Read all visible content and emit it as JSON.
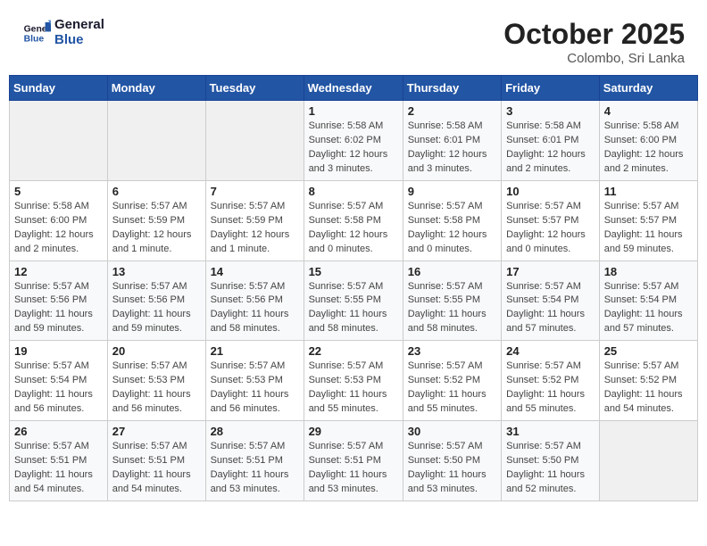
{
  "header": {
    "logo_general": "General",
    "logo_blue": "Blue",
    "month_year": "October 2025",
    "location": "Colombo, Sri Lanka"
  },
  "weekdays": [
    "Sunday",
    "Monday",
    "Tuesday",
    "Wednesday",
    "Thursday",
    "Friday",
    "Saturday"
  ],
  "weeks": [
    [
      {
        "day": "",
        "info": ""
      },
      {
        "day": "",
        "info": ""
      },
      {
        "day": "",
        "info": ""
      },
      {
        "day": "1",
        "info": "Sunrise: 5:58 AM\nSunset: 6:02 PM\nDaylight: 12 hours\nand 3 minutes."
      },
      {
        "day": "2",
        "info": "Sunrise: 5:58 AM\nSunset: 6:01 PM\nDaylight: 12 hours\nand 3 minutes."
      },
      {
        "day": "3",
        "info": "Sunrise: 5:58 AM\nSunset: 6:01 PM\nDaylight: 12 hours\nand 2 minutes."
      },
      {
        "day": "4",
        "info": "Sunrise: 5:58 AM\nSunset: 6:00 PM\nDaylight: 12 hours\nand 2 minutes."
      }
    ],
    [
      {
        "day": "5",
        "info": "Sunrise: 5:58 AM\nSunset: 6:00 PM\nDaylight: 12 hours\nand 2 minutes."
      },
      {
        "day": "6",
        "info": "Sunrise: 5:57 AM\nSunset: 5:59 PM\nDaylight: 12 hours\nand 1 minute."
      },
      {
        "day": "7",
        "info": "Sunrise: 5:57 AM\nSunset: 5:59 PM\nDaylight: 12 hours\nand 1 minute."
      },
      {
        "day": "8",
        "info": "Sunrise: 5:57 AM\nSunset: 5:58 PM\nDaylight: 12 hours\nand 0 minutes."
      },
      {
        "day": "9",
        "info": "Sunrise: 5:57 AM\nSunset: 5:58 PM\nDaylight: 12 hours\nand 0 minutes."
      },
      {
        "day": "10",
        "info": "Sunrise: 5:57 AM\nSunset: 5:57 PM\nDaylight: 12 hours\nand 0 minutes."
      },
      {
        "day": "11",
        "info": "Sunrise: 5:57 AM\nSunset: 5:57 PM\nDaylight: 11 hours\nand 59 minutes."
      }
    ],
    [
      {
        "day": "12",
        "info": "Sunrise: 5:57 AM\nSunset: 5:56 PM\nDaylight: 11 hours\nand 59 minutes."
      },
      {
        "day": "13",
        "info": "Sunrise: 5:57 AM\nSunset: 5:56 PM\nDaylight: 11 hours\nand 59 minutes."
      },
      {
        "day": "14",
        "info": "Sunrise: 5:57 AM\nSunset: 5:56 PM\nDaylight: 11 hours\nand 58 minutes."
      },
      {
        "day": "15",
        "info": "Sunrise: 5:57 AM\nSunset: 5:55 PM\nDaylight: 11 hours\nand 58 minutes."
      },
      {
        "day": "16",
        "info": "Sunrise: 5:57 AM\nSunset: 5:55 PM\nDaylight: 11 hours\nand 58 minutes."
      },
      {
        "day": "17",
        "info": "Sunrise: 5:57 AM\nSunset: 5:54 PM\nDaylight: 11 hours\nand 57 minutes."
      },
      {
        "day": "18",
        "info": "Sunrise: 5:57 AM\nSunset: 5:54 PM\nDaylight: 11 hours\nand 57 minutes."
      }
    ],
    [
      {
        "day": "19",
        "info": "Sunrise: 5:57 AM\nSunset: 5:54 PM\nDaylight: 11 hours\nand 56 minutes."
      },
      {
        "day": "20",
        "info": "Sunrise: 5:57 AM\nSunset: 5:53 PM\nDaylight: 11 hours\nand 56 minutes."
      },
      {
        "day": "21",
        "info": "Sunrise: 5:57 AM\nSunset: 5:53 PM\nDaylight: 11 hours\nand 56 minutes."
      },
      {
        "day": "22",
        "info": "Sunrise: 5:57 AM\nSunset: 5:53 PM\nDaylight: 11 hours\nand 55 minutes."
      },
      {
        "day": "23",
        "info": "Sunrise: 5:57 AM\nSunset: 5:52 PM\nDaylight: 11 hours\nand 55 minutes."
      },
      {
        "day": "24",
        "info": "Sunrise: 5:57 AM\nSunset: 5:52 PM\nDaylight: 11 hours\nand 55 minutes."
      },
      {
        "day": "25",
        "info": "Sunrise: 5:57 AM\nSunset: 5:52 PM\nDaylight: 11 hours\nand 54 minutes."
      }
    ],
    [
      {
        "day": "26",
        "info": "Sunrise: 5:57 AM\nSunset: 5:51 PM\nDaylight: 11 hours\nand 54 minutes."
      },
      {
        "day": "27",
        "info": "Sunrise: 5:57 AM\nSunset: 5:51 PM\nDaylight: 11 hours\nand 54 minutes."
      },
      {
        "day": "28",
        "info": "Sunrise: 5:57 AM\nSunset: 5:51 PM\nDaylight: 11 hours\nand 53 minutes."
      },
      {
        "day": "29",
        "info": "Sunrise: 5:57 AM\nSunset: 5:51 PM\nDaylight: 11 hours\nand 53 minutes."
      },
      {
        "day": "30",
        "info": "Sunrise: 5:57 AM\nSunset: 5:50 PM\nDaylight: 11 hours\nand 53 minutes."
      },
      {
        "day": "31",
        "info": "Sunrise: 5:57 AM\nSunset: 5:50 PM\nDaylight: 11 hours\nand 52 minutes."
      },
      {
        "day": "",
        "info": ""
      }
    ]
  ]
}
